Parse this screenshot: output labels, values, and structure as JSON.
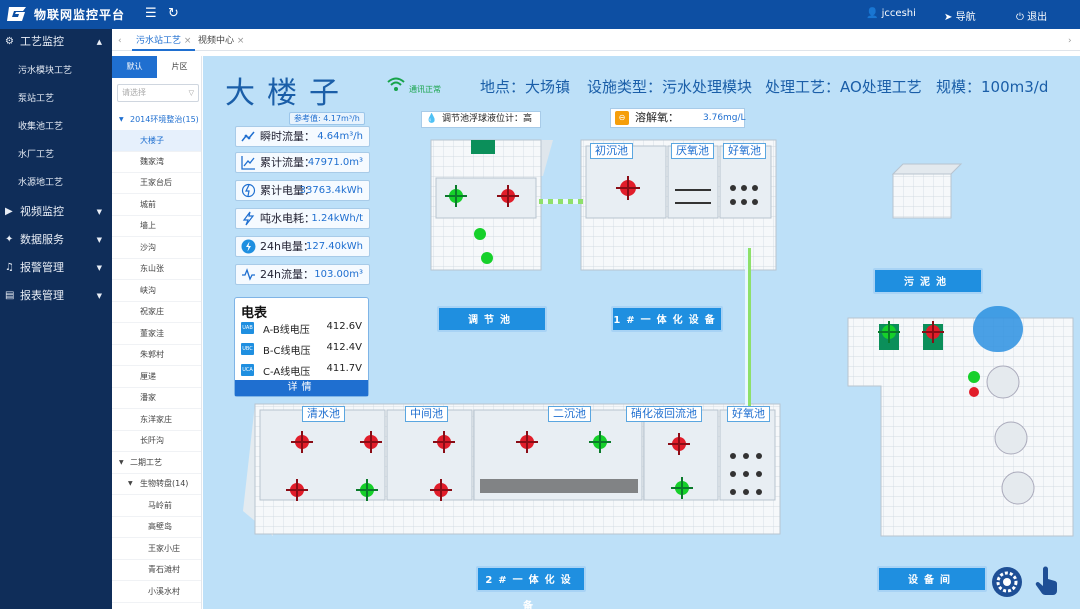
{
  "app": {
    "title": "物联网监控平台"
  },
  "topbar": {
    "user": "jcceshi",
    "nav": "导航",
    "logout": "退出"
  },
  "leftnav": {
    "groups": [
      {
        "label": "工艺监控",
        "expanded": true
      },
      {
        "label": "视频监控"
      },
      {
        "label": "数据服务"
      },
      {
        "label": "报警管理"
      },
      {
        "label": "报表管理"
      }
    ],
    "subitems": [
      "污水模块工艺",
      "泵站工艺",
      "收集池工艺",
      "水厂工艺",
      "水源地工艺"
    ]
  },
  "tabs": [
    {
      "label": "污水站工艺",
      "active": true
    },
    {
      "label": "视频中心",
      "active": false
    }
  ],
  "tree": {
    "tab_default": "默认",
    "tab_area": "片区",
    "select_placeholder": "请选择",
    "cat1": "2014环境整治(15)",
    "cat1_items": [
      "大楼子",
      "魏家湾",
      "王家台后",
      "城前",
      "墙上",
      "沙沟",
      "东山张",
      "峡沟",
      "祝家庄",
      "董家洼",
      "朱郭村",
      "厘递",
      "潘家",
      "东洋家庄",
      "长阡沟"
    ],
    "cat2": "二期工艺",
    "cat3": "生物转盘(14)",
    "cat3_items": [
      "马岭前",
      "高壁岛",
      "王家小庄",
      "青石滩村",
      "小溪水村"
    ]
  },
  "header": {
    "site": "大楼子",
    "comm_status": "通讯正常",
    "location": "地点：大场镇",
    "device_type": "设施类型：污水处理模块",
    "process": "处理工艺：AO处理工艺",
    "scale": "规模：100m3/d"
  },
  "metrics": {
    "ref_value": "参考值: 4.17m³/h",
    "instant_flow_label": "瞬时流量：",
    "instant_flow": "4.64m³/h",
    "cum_flow_label": "累计流量：",
    "cum_flow": "47971.0m³",
    "cum_power_label": "累计电量：",
    "cum_power": "33763.4kWh",
    "ton_power_label": "吨水电耗：",
    "ton_power": "1.24kWh/t",
    "power24_label": "24h电量：",
    "power24": "127.40kWh",
    "flow24_label": "24h流量：",
    "flow24": "103.00m³"
  },
  "meter": {
    "title": "电表",
    "rows": [
      {
        "tag": "UAB",
        "label": "A-B线电压",
        "value": "412.6V"
      },
      {
        "tag": "UBC",
        "label": "B-C线电压",
        "value": "412.4V"
      },
      {
        "tag": "UCA",
        "label": "C-A线电压",
        "value": "411.7V"
      }
    ],
    "details": "详情"
  },
  "badges": {
    "float_level": "调节池浮球液位计：高",
    "do_label": "溶解氧：",
    "do_value": "3.76mg/L"
  },
  "tanks": {
    "primary": "初沉池",
    "anoxic": "厌氧池",
    "aerobic1": "好氧池",
    "clear": "清水池",
    "middle": "中间池",
    "secondary": "二沉池",
    "nitrification": "硝化液回流池",
    "aerobic2": "好氧池"
  },
  "tags": {
    "regulating": "调节池",
    "unit1": "1#一体化设备",
    "sludge": "污泥池",
    "unit2": "2#一体化设备",
    "equipment": "设备间"
  },
  "colors": {
    "topbar": "#0d4fa3",
    "leftnav": "#0f2d59",
    "accent": "#1f6fd0",
    "canvas": "#bde0f8",
    "ok": "#16a34a",
    "alarm": "#e11d2a"
  }
}
